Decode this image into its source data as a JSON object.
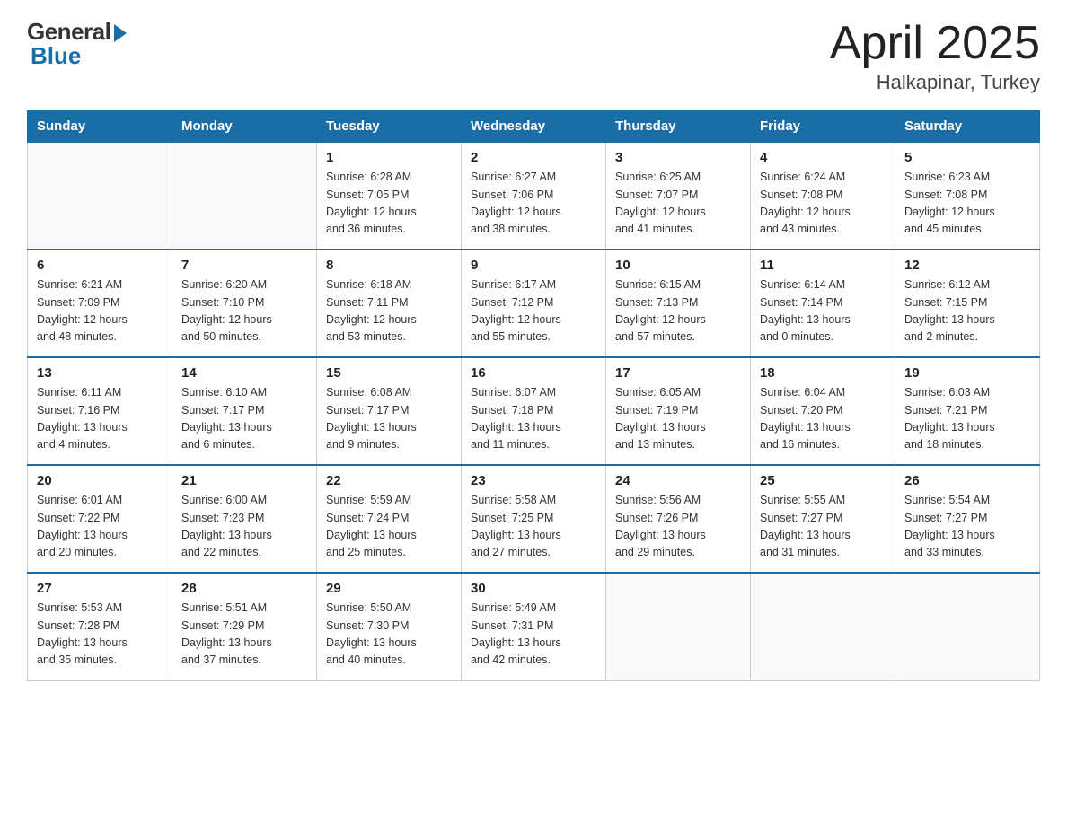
{
  "header": {
    "logo_general": "General",
    "logo_blue": "Blue",
    "title": "April 2025",
    "location": "Halkapinar, Turkey"
  },
  "weekdays": [
    "Sunday",
    "Monday",
    "Tuesday",
    "Wednesday",
    "Thursday",
    "Friday",
    "Saturday"
  ],
  "weeks": [
    [
      {
        "day": "",
        "info": ""
      },
      {
        "day": "",
        "info": ""
      },
      {
        "day": "1",
        "info": "Sunrise: 6:28 AM\nSunset: 7:05 PM\nDaylight: 12 hours\nand 36 minutes."
      },
      {
        "day": "2",
        "info": "Sunrise: 6:27 AM\nSunset: 7:06 PM\nDaylight: 12 hours\nand 38 minutes."
      },
      {
        "day": "3",
        "info": "Sunrise: 6:25 AM\nSunset: 7:07 PM\nDaylight: 12 hours\nand 41 minutes."
      },
      {
        "day": "4",
        "info": "Sunrise: 6:24 AM\nSunset: 7:08 PM\nDaylight: 12 hours\nand 43 minutes."
      },
      {
        "day": "5",
        "info": "Sunrise: 6:23 AM\nSunset: 7:08 PM\nDaylight: 12 hours\nand 45 minutes."
      }
    ],
    [
      {
        "day": "6",
        "info": "Sunrise: 6:21 AM\nSunset: 7:09 PM\nDaylight: 12 hours\nand 48 minutes."
      },
      {
        "day": "7",
        "info": "Sunrise: 6:20 AM\nSunset: 7:10 PM\nDaylight: 12 hours\nand 50 minutes."
      },
      {
        "day": "8",
        "info": "Sunrise: 6:18 AM\nSunset: 7:11 PM\nDaylight: 12 hours\nand 53 minutes."
      },
      {
        "day": "9",
        "info": "Sunrise: 6:17 AM\nSunset: 7:12 PM\nDaylight: 12 hours\nand 55 minutes."
      },
      {
        "day": "10",
        "info": "Sunrise: 6:15 AM\nSunset: 7:13 PM\nDaylight: 12 hours\nand 57 minutes."
      },
      {
        "day": "11",
        "info": "Sunrise: 6:14 AM\nSunset: 7:14 PM\nDaylight: 13 hours\nand 0 minutes."
      },
      {
        "day": "12",
        "info": "Sunrise: 6:12 AM\nSunset: 7:15 PM\nDaylight: 13 hours\nand 2 minutes."
      }
    ],
    [
      {
        "day": "13",
        "info": "Sunrise: 6:11 AM\nSunset: 7:16 PM\nDaylight: 13 hours\nand 4 minutes."
      },
      {
        "day": "14",
        "info": "Sunrise: 6:10 AM\nSunset: 7:17 PM\nDaylight: 13 hours\nand 6 minutes."
      },
      {
        "day": "15",
        "info": "Sunrise: 6:08 AM\nSunset: 7:17 PM\nDaylight: 13 hours\nand 9 minutes."
      },
      {
        "day": "16",
        "info": "Sunrise: 6:07 AM\nSunset: 7:18 PM\nDaylight: 13 hours\nand 11 minutes."
      },
      {
        "day": "17",
        "info": "Sunrise: 6:05 AM\nSunset: 7:19 PM\nDaylight: 13 hours\nand 13 minutes."
      },
      {
        "day": "18",
        "info": "Sunrise: 6:04 AM\nSunset: 7:20 PM\nDaylight: 13 hours\nand 16 minutes."
      },
      {
        "day": "19",
        "info": "Sunrise: 6:03 AM\nSunset: 7:21 PM\nDaylight: 13 hours\nand 18 minutes."
      }
    ],
    [
      {
        "day": "20",
        "info": "Sunrise: 6:01 AM\nSunset: 7:22 PM\nDaylight: 13 hours\nand 20 minutes."
      },
      {
        "day": "21",
        "info": "Sunrise: 6:00 AM\nSunset: 7:23 PM\nDaylight: 13 hours\nand 22 minutes."
      },
      {
        "day": "22",
        "info": "Sunrise: 5:59 AM\nSunset: 7:24 PM\nDaylight: 13 hours\nand 25 minutes."
      },
      {
        "day": "23",
        "info": "Sunrise: 5:58 AM\nSunset: 7:25 PM\nDaylight: 13 hours\nand 27 minutes."
      },
      {
        "day": "24",
        "info": "Sunrise: 5:56 AM\nSunset: 7:26 PM\nDaylight: 13 hours\nand 29 minutes."
      },
      {
        "day": "25",
        "info": "Sunrise: 5:55 AM\nSunset: 7:27 PM\nDaylight: 13 hours\nand 31 minutes."
      },
      {
        "day": "26",
        "info": "Sunrise: 5:54 AM\nSunset: 7:27 PM\nDaylight: 13 hours\nand 33 minutes."
      }
    ],
    [
      {
        "day": "27",
        "info": "Sunrise: 5:53 AM\nSunset: 7:28 PM\nDaylight: 13 hours\nand 35 minutes."
      },
      {
        "day": "28",
        "info": "Sunrise: 5:51 AM\nSunset: 7:29 PM\nDaylight: 13 hours\nand 37 minutes."
      },
      {
        "day": "29",
        "info": "Sunrise: 5:50 AM\nSunset: 7:30 PM\nDaylight: 13 hours\nand 40 minutes."
      },
      {
        "day": "30",
        "info": "Sunrise: 5:49 AM\nSunset: 7:31 PM\nDaylight: 13 hours\nand 42 minutes."
      },
      {
        "day": "",
        "info": ""
      },
      {
        "day": "",
        "info": ""
      },
      {
        "day": "",
        "info": ""
      }
    ]
  ]
}
